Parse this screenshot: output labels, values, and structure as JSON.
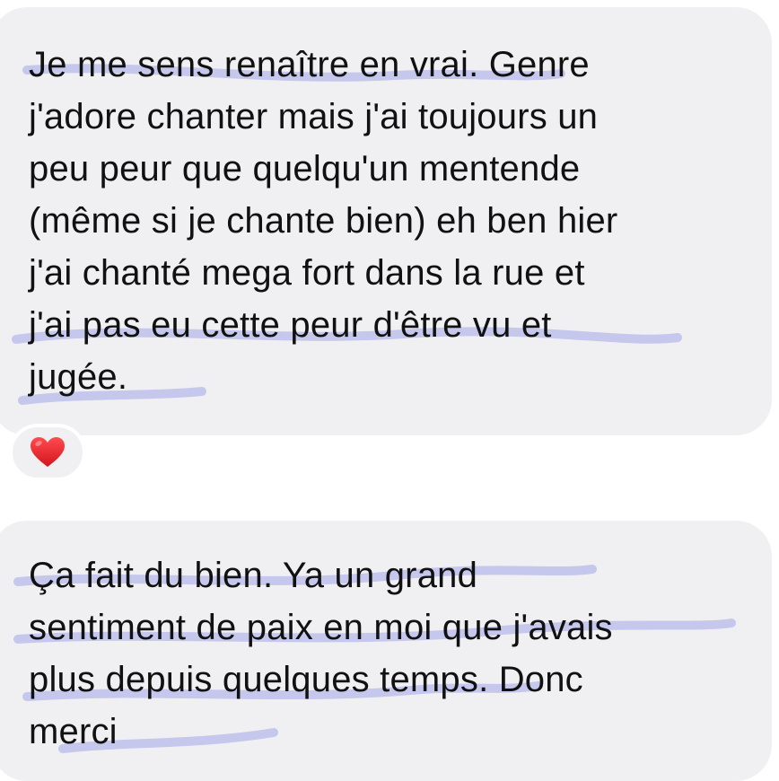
{
  "conversation": {
    "messages": [
      {
        "lines": [
          "Je me sens renaître en vrai. Genre",
          "j'adore chanter mais j'ai toujours un",
          "peu peur que quelqu'un mentende",
          "(même si je chante bien) eh ben hier",
          "j'ai chanté mega fort dans la rue et",
          "j'ai pas eu cette peur d'être vu et",
          "jugée."
        ],
        "reaction": "heart-icon"
      },
      {
        "lines": [
          "Ça fait du bien. Ya un grand",
          "sentiment de paix en moi que j'avais",
          "plus depuis quelques temps. Donc",
          "merci"
        ]
      }
    ]
  },
  "colors": {
    "bubble": "#f0f0f3",
    "text": "#111111",
    "highlight": "#6b6fe0",
    "heart": "#e3242b"
  }
}
